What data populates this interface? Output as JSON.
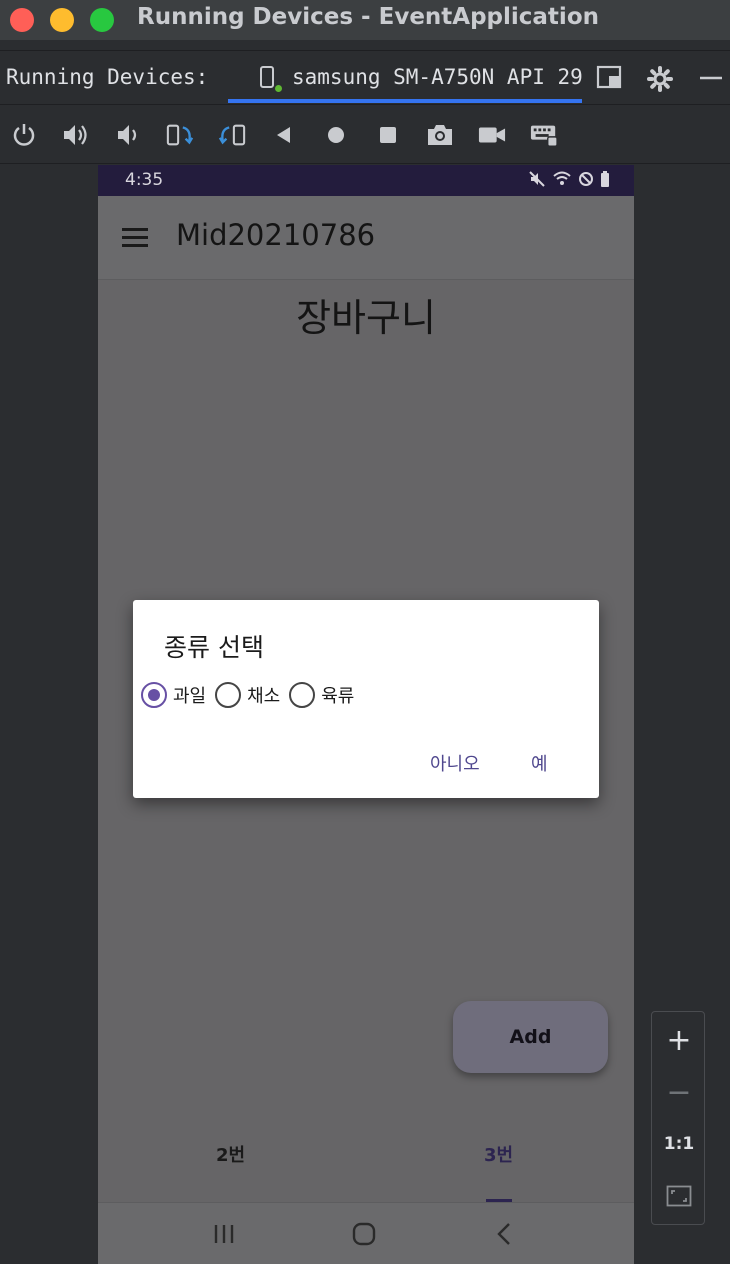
{
  "window": {
    "title": "Running Devices - EventApplication"
  },
  "tabs": {
    "label": "Running Devices:",
    "device": "samsung SM-A750N API 29"
  },
  "toolbar": {
    "icons": [
      "power-icon",
      "volume-up-icon",
      "volume-down-icon",
      "rotate-left-icon",
      "rotate-right-icon",
      "back-icon",
      "home-icon",
      "overview-icon",
      "screenshot-icon",
      "record-icon",
      "keyboard-icon"
    ]
  },
  "device": {
    "status": {
      "time": "4:35"
    },
    "app": {
      "title": "Mid20210786",
      "heading": "장바구니"
    },
    "fab": {
      "label": "Add"
    },
    "bottom_tabs": [
      "2번",
      "3번"
    ]
  },
  "dialog": {
    "title": "종류 선택",
    "options": [
      {
        "label": "과일",
        "checked": true
      },
      {
        "label": "채소",
        "checked": false
      },
      {
        "label": "육류",
        "checked": false
      }
    ],
    "negative": "아니오",
    "positive": "예"
  },
  "zoom": {
    "plus": "+",
    "minus": "−",
    "one_to_one": "1:1"
  },
  "colors": {
    "accent": "#6750a4",
    "dialog_button": "#4f478e",
    "statusbar": "#231c3d",
    "tab_underline": "#3574f0"
  }
}
